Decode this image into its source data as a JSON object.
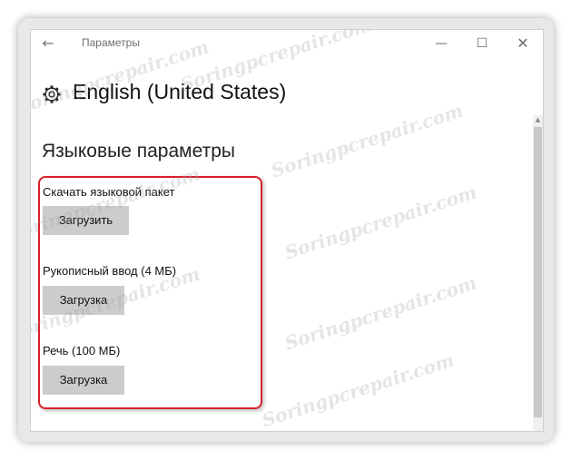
{
  "window": {
    "title": "Параметры",
    "back_icon": "←",
    "minimize_icon": "—",
    "maximize_icon": "☐",
    "close_icon": "✕"
  },
  "header": {
    "title": "English (United States)",
    "icon": "gear-icon"
  },
  "section": {
    "title": "Языковые параметры"
  },
  "items": [
    {
      "label": "Скачать языковой пакет",
      "button": "Загрузить"
    },
    {
      "label": "Рукописный ввод (4 МБ)",
      "button": "Загрузка"
    },
    {
      "label": "Речь (100 МБ)",
      "button": "Загрузка"
    }
  ],
  "watermark": "Soringpcrepair.com",
  "colors": {
    "highlight": "#d8202c",
    "button_bg": "#cccccc"
  }
}
